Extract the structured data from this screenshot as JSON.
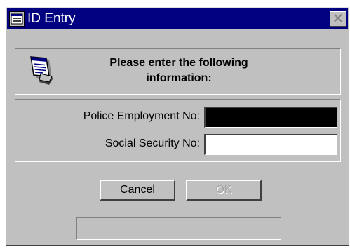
{
  "window": {
    "title": "ID Entry",
    "title_icon": "window-icon",
    "close_glyph": "✕",
    "titlebar_color": "#000080",
    "face_color": "#c0c0c0"
  },
  "banner": {
    "icon": "id-card-icon",
    "line1": "Please enter the following",
    "line2": "information:"
  },
  "form": {
    "employment_label": "Police Employment No:",
    "employment_value": "",
    "ssn_label": "Social Security No:",
    "ssn_value": ""
  },
  "buttons": {
    "cancel_label": "Cancel",
    "ok_label": "OK",
    "ok_enabled": false
  },
  "status": {
    "text": ""
  }
}
